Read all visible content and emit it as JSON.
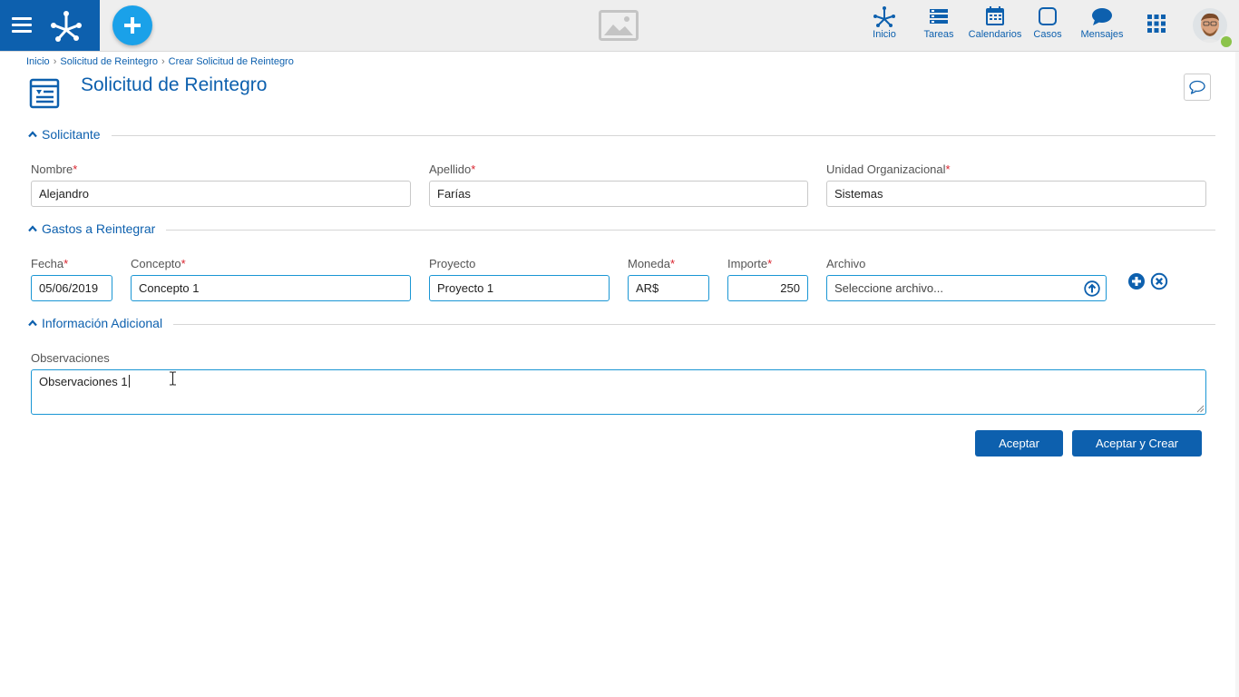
{
  "colors": {
    "primary": "#0d60ae",
    "accent": "#1aa1e9",
    "required": "#d9232e",
    "online": "#8bc34a",
    "active_border": "#1a96d4"
  },
  "header": {
    "menu_icon": "hamburger-icon",
    "logo_icon": "network-logo-icon",
    "add_icon": "plus-icon",
    "image_icon": "image-placeholder-icon",
    "nav": [
      {
        "label": "Inicio",
        "icon": "home-network-icon"
      },
      {
        "label": "Tareas",
        "icon": "tasks-icon"
      },
      {
        "label": "Calendarios",
        "icon": "calendar-icon"
      },
      {
        "label": "Casos",
        "icon": "cases-icon"
      },
      {
        "label": "Mensajes",
        "icon": "chat-bubble-icon"
      }
    ],
    "apps_icon": "grid-apps-icon",
    "user_status": "online"
  },
  "breadcrumb": [
    "Inicio",
    "Solicitud de Reintegro",
    "Crear Solicitud de Reintegro"
  ],
  "page": {
    "title": "Solicitud de Reintegro",
    "icon": "form-document-icon",
    "comment_icon": "comment-icon"
  },
  "sections": {
    "solicitante": {
      "title": "Solicitante",
      "fields": {
        "nombre": {
          "label": "Nombre",
          "value": "Alejandro",
          "required": true
        },
        "apellido": {
          "label": "Apellido",
          "value": "Farías",
          "required": true
        },
        "unidad": {
          "label": "Unidad Organizacional",
          "value": "Sistemas",
          "required": true
        }
      }
    },
    "gastos": {
      "title": "Gastos a Reintegrar",
      "columns": {
        "fecha": {
          "label": "Fecha",
          "required": true
        },
        "concepto": {
          "label": "Concepto",
          "required": true
        },
        "proyecto": {
          "label": "Proyecto",
          "required": false
        },
        "moneda": {
          "label": "Moneda",
          "required": true
        },
        "importe": {
          "label": "Importe",
          "required": true
        },
        "archivo": {
          "label": "Archivo",
          "required": false
        }
      },
      "rows": [
        {
          "fecha": "05/06/2019",
          "concepto": "Concepto 1",
          "proyecto": "Proyecto 1",
          "moneda": "AR$",
          "importe": "250",
          "archivo": "Seleccione archivo..."
        }
      ]
    },
    "adicional": {
      "title": "Información Adicional",
      "fields": {
        "observaciones": {
          "label": "Observaciones",
          "value": "Observaciones 1"
        }
      }
    }
  },
  "buttons": {
    "accept": "Aceptar",
    "accept_create": "Aceptar y Crear"
  },
  "required_mark": "*"
}
